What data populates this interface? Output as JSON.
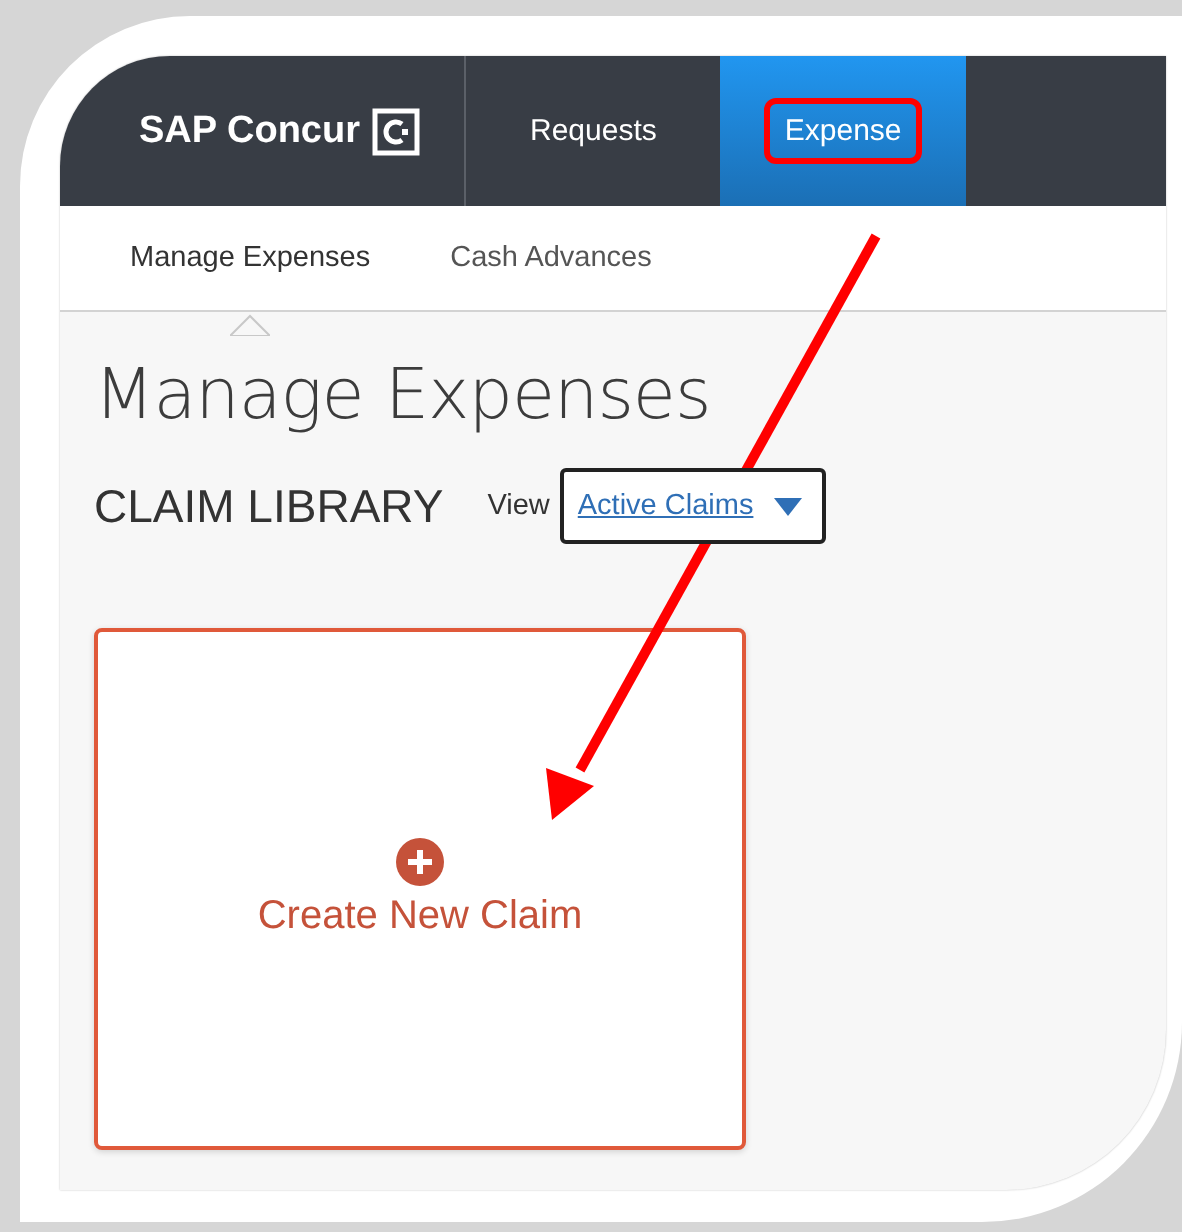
{
  "brand": {
    "name": "SAP Concur"
  },
  "nav": [
    {
      "label": "Requests",
      "selected": false,
      "highlighted": false
    },
    {
      "label": "Expense",
      "selected": true,
      "highlighted": true
    }
  ],
  "subnav": [
    {
      "label": "Manage Expenses",
      "selected": true
    },
    {
      "label": "Cash Advances",
      "selected": false
    }
  ],
  "page_title": "Manage Expenses",
  "library": {
    "heading": "CLAIM LIBRARY",
    "view_label": "View",
    "view_value": "Active Claims"
  },
  "create_card": {
    "label": "Create New Claim"
  },
  "annotation_arrow": true
}
